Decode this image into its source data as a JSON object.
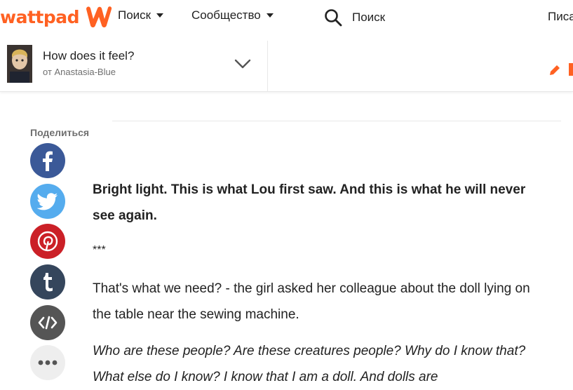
{
  "nav": {
    "logo_text": "wattpad",
    "browse_label": "Поиск",
    "community_label": "Сообщество",
    "search_placeholder": "Поиск",
    "write_label": "Писа"
  },
  "story": {
    "title": "How does it feel?",
    "author": "от Anastasia-Blue"
  },
  "share": {
    "label": "Поделиться",
    "buttons": [
      "facebook",
      "twitter",
      "pinterest",
      "tumblr",
      "embed",
      "more"
    ]
  },
  "colors": {
    "brand": "#ff6122",
    "facebook": "#3b5998",
    "twitter": "#55acee",
    "pinterest": "#cb2027",
    "tumblr": "#35465c",
    "embed": "#555555",
    "more": "#eeeeee"
  },
  "content": {
    "p1": "Bright light. This is what Lou first saw. And this is what he will never see again.",
    "stars": "***",
    "p2": "That's what we need? - the girl asked her colleague about the doll lying on the table near the sewing machine.",
    "p3": "Who are these people? Are these creatures people? Why do I know that? What else do I know? I know that I am a doll. And dolls are"
  }
}
